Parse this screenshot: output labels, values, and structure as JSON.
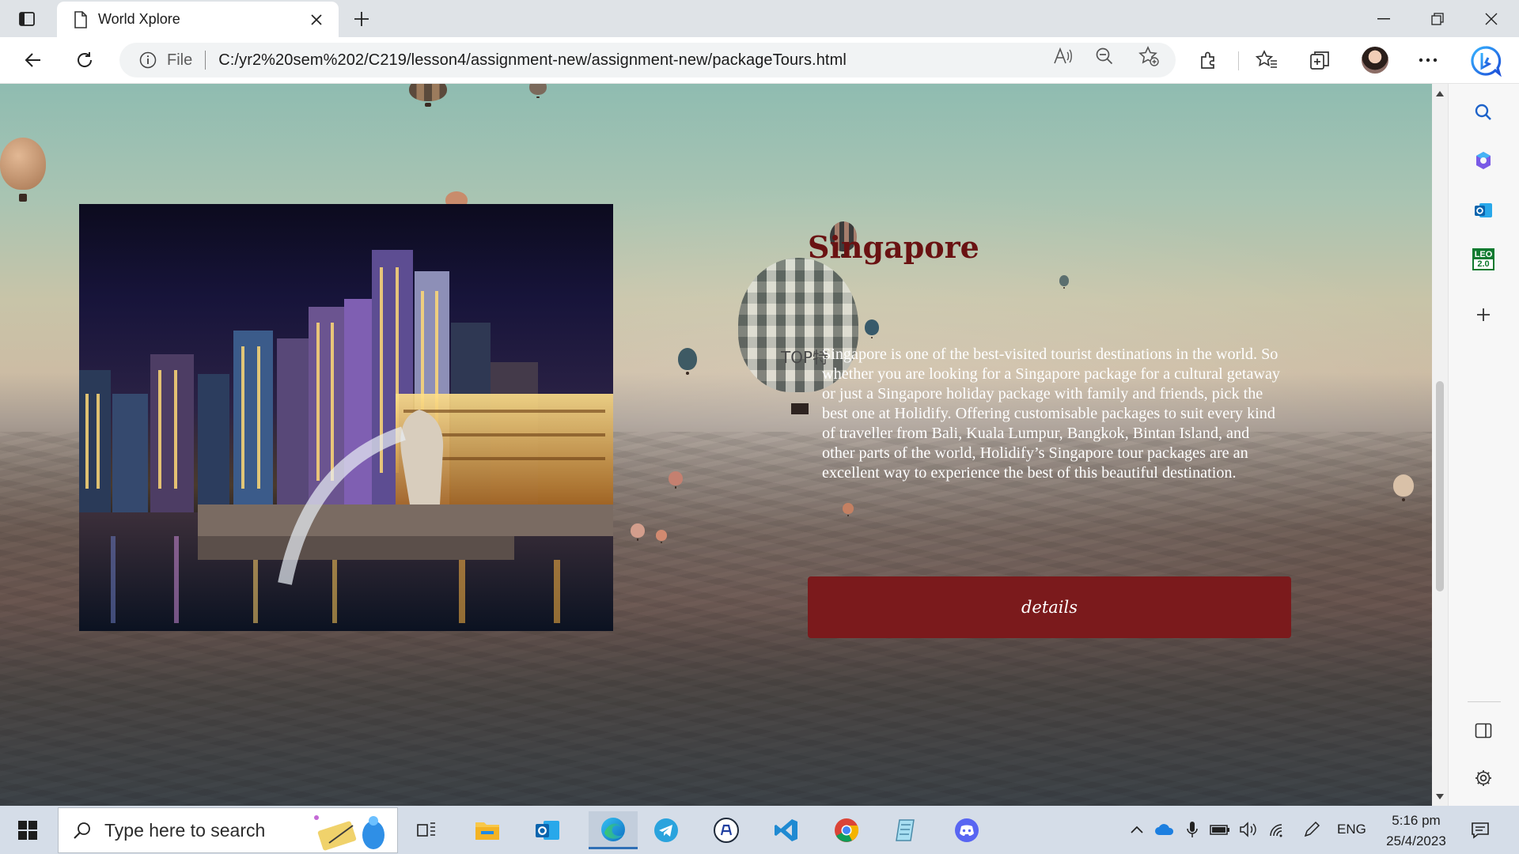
{
  "browser": {
    "tab_title": "World Xplore",
    "address_scheme": "File",
    "address_url": "C:/yr2%20sem%202/C219/lesson4/assignment-new/assignment-new/packageTours.html"
  },
  "page": {
    "heading": "Singapore",
    "description": "Singapore is one of the best-visited tourist destinations in the world. So whether you are looking for a Singapore package for a cultural getaway or just a Singapore holiday package with family and friends, pick the best one at Holidify. Offering customisable packages to suit every kind of traveller from Bali, Kuala Lumpur, Bangkok, Bintan Island, and other parts of the world, Holidify’s Singapore tour packages are an excellent way to experience the best of this beautiful destination.",
    "button_label": "details",
    "photo_subject": "Singapore skyline at night with Merlion",
    "balloon_text": "TOP特"
  },
  "colors": {
    "heading": "#6a1212",
    "button_bg": "#7b1a1c",
    "accent": "#2f6fb5"
  },
  "taskbar": {
    "search_placeholder": "Type here to search",
    "language": "ENG",
    "time": "5:16 pm",
    "date": "25/4/2023",
    "apps": [
      "task-view-icon",
      "file-explorer-icon",
      "outlook-icon",
      "edge-icon",
      "telegram-icon",
      "clock-app-icon",
      "vscode-icon",
      "chrome-icon",
      "notepad-icon",
      "discord-icon"
    ]
  },
  "sidebar": {
    "leo_badge_line1": "LEO",
    "leo_badge_line2": "2.0"
  }
}
